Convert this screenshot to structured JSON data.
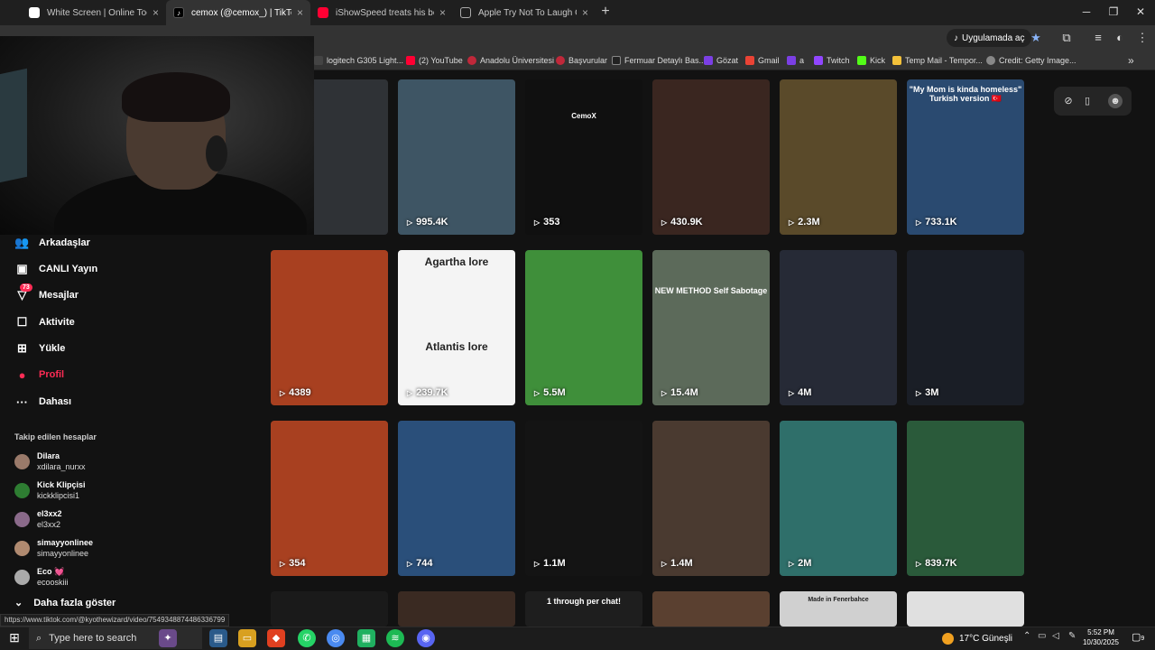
{
  "browser": {
    "tabs": [
      {
        "title": "White Screen | Online Tool",
        "active": false,
        "favicon_color": "#ffffff"
      },
      {
        "title": "cemox (@cemox_) | TikTok",
        "active": true,
        "favicon_color": "#000000"
      },
      {
        "title": "iShowSpeed treats his bodygua",
        "active": false,
        "favicon_color": "#ff0033"
      },
      {
        "title": "Apple Try Not To Laugh GIF - Fi",
        "active": false,
        "favicon_color": "#444444"
      }
    ],
    "new_tab_label": "+",
    "app_button_label": "Uygulamada aç",
    "bookmarks": [
      {
        "label": "logitech G305 Light...",
        "color": "#444444"
      },
      {
        "label": "(2) YouTube",
        "color": "#ff0033"
      },
      {
        "label": "Anadolu Üniversitesi",
        "color": "#c0283a"
      },
      {
        "label": "Başvurular",
        "color": "#c0283a"
      },
      {
        "label": "Fermuar Detaylı Bas...",
        "color": "#222222"
      },
      {
        "label": "Gözat",
        "color": "#7b3fe4"
      },
      {
        "label": "Gmail",
        "color": "#ea4335"
      },
      {
        "label": "a",
        "color": "#7b3fe4"
      },
      {
        "label": "Twitch",
        "color": "#9146ff"
      },
      {
        "label": "Kick",
        "color": "#53fc18"
      },
      {
        "label": "Temp Mail - Tempor...",
        "color": "#f3c13a"
      },
      {
        "label": "Credit: Getty Image...",
        "color": "#888888"
      }
    ]
  },
  "sidebar": {
    "nav": [
      {
        "label": "Arkadaşlar",
        "icon": "friends-icon",
        "active": false
      },
      {
        "label": "CANLI Yayın",
        "icon": "live-icon",
        "active": false
      },
      {
        "label": "Mesajlar",
        "icon": "messages-icon",
        "active": false,
        "badge": "73"
      },
      {
        "label": "Aktivite",
        "icon": "activity-icon",
        "active": false
      },
      {
        "label": "Yükle",
        "icon": "upload-icon",
        "active": false
      },
      {
        "label": "Profil",
        "icon": "profile-icon",
        "active": true
      },
      {
        "label": "Dahası",
        "icon": "more-icon",
        "active": false
      }
    ],
    "following_title": "Takip edilen hesaplar",
    "following": [
      {
        "name": "Dilara",
        "username": "xdilara_nurxx",
        "color": "#9a7a6a"
      },
      {
        "name": "Kick Klipçisi",
        "username": "kickklipcisi1",
        "color": "#2e7d32"
      },
      {
        "name": "el3xx2",
        "username": "el3xx2",
        "color": "#8a6a8a"
      },
      {
        "name": "simayyonlinee",
        "username": "simayyonlinee",
        "color": "#b08a70"
      },
      {
        "name": "Eco 💓",
        "username": "ecooskiii",
        "color": "#aaaaaa"
      }
    ],
    "show_more": "Daha fazla göster"
  },
  "videos": [
    {
      "views": "",
      "bg": "#2f3236",
      "caption": ""
    },
    {
      "views": "995.4K",
      "bg": "#3e5564",
      "caption": ""
    },
    {
      "views": "353",
      "bg": "#101010",
      "caption": "CemoX"
    },
    {
      "views": "430.9K",
      "bg": "#3a2620",
      "caption": ""
    },
    {
      "views": "2.3M",
      "bg": "#5a4a2a",
      "caption": ""
    },
    {
      "views": "733.1K",
      "bg": "#2a4a70",
      "caption": "\"My Mom is kinda homeless\" Turkish version 🇹🇷"
    },
    {
      "views": "4389",
      "bg": "#a84020",
      "caption": ""
    },
    {
      "views": "239.7K",
      "bg": "#f4f4f4",
      "caption": "Agartha lore",
      "caption2": "Atlantis lore"
    },
    {
      "views": "5.5M",
      "bg": "#3f8f3a",
      "caption": ""
    },
    {
      "views": "15.4M",
      "bg": "#5c6a5a",
      "caption": "NEW METHOD Self Sabotage"
    },
    {
      "views": "4M",
      "bg": "#262a36",
      "caption": ""
    },
    {
      "views": "3M",
      "bg": "#1a1e26",
      "caption": ""
    },
    {
      "views": "354",
      "bg": "#a84020",
      "caption": ""
    },
    {
      "views": "744",
      "bg": "#2a4f7a",
      "caption": ""
    },
    {
      "views": "1.1M",
      "bg": "#141414",
      "caption": ""
    },
    {
      "views": "1.4M",
      "bg": "#4a3a30",
      "caption": ""
    },
    {
      "views": "2M",
      "bg": "#2f6f6a",
      "caption": ""
    },
    {
      "views": "839.7K",
      "bg": "#2a5a3a",
      "caption": ""
    },
    {
      "views": "",
      "bg": "#1a1a1a",
      "caption": ""
    },
    {
      "views": "",
      "bg": "#3a2a22",
      "caption": ""
    },
    {
      "views": "",
      "bg": "#1e1e1e",
      "caption": "1 through per chat!"
    },
    {
      "views": "",
      "bg": "#5a4030",
      "caption": ""
    },
    {
      "views": "",
      "bg": "#d0d0d0",
      "caption": "Made in Fenerbahce"
    },
    {
      "views": "",
      "bg": "#e0e0e0",
      "caption": ""
    }
  ],
  "status_url": "https://www.tiktok.com/@kyothewizard/video/7549348874486336799",
  "taskbar": {
    "search_placeholder": "Type here to search",
    "weather": "17°C Güneşli",
    "time": "5:52 PM",
    "date": "10/30/2025",
    "notification_count": "9"
  },
  "colors": {
    "accent": "#fe2c55",
    "page_bg": "#121212",
    "chrome_bg": "#333333"
  }
}
